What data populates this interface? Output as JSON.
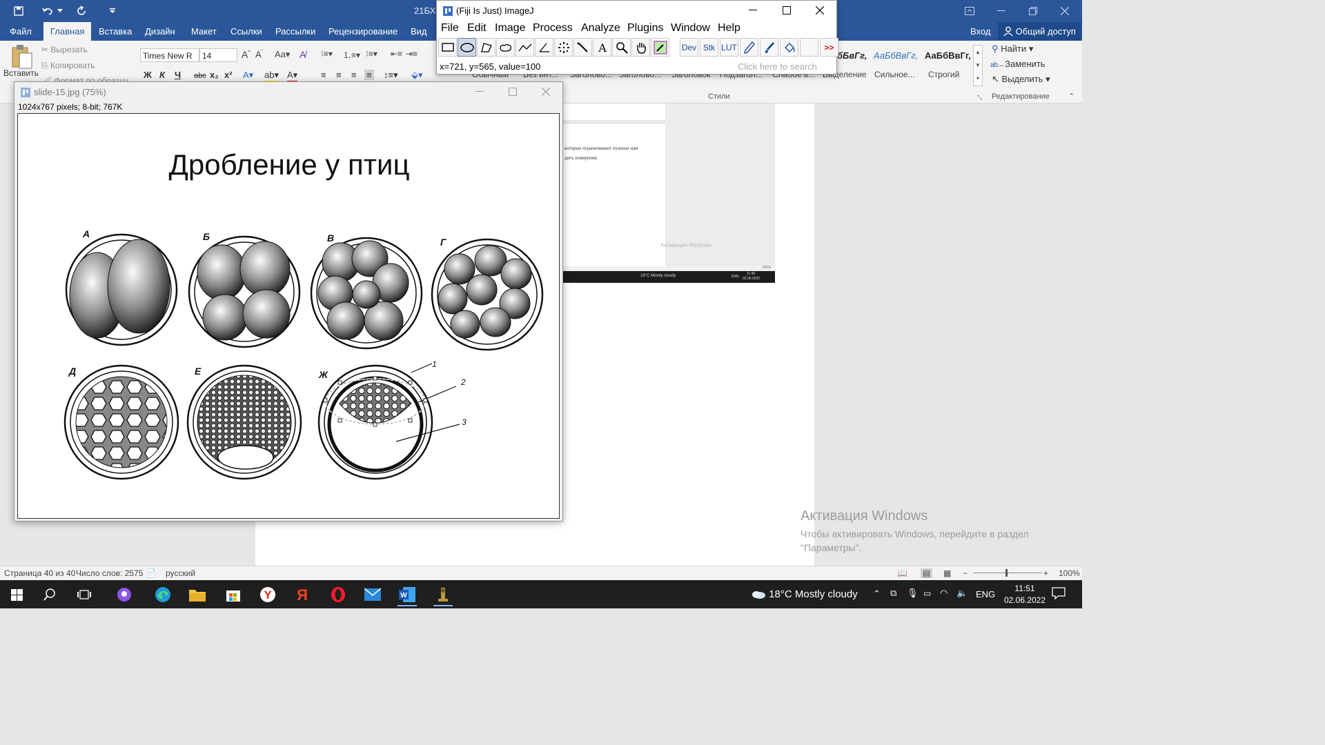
{
  "word": {
    "doc_title": "21БХ",
    "tabs": [
      "Файл",
      "Главная",
      "Вставка",
      "Дизайн",
      "Макет",
      "Ссылки",
      "Рассылки",
      "Рецензирование",
      "Вид"
    ],
    "active_tab": "Главная",
    "signin": "Вход",
    "share": "Общий доступ",
    "clipboard": {
      "paste": "Вставить",
      "cut": "Вырезать",
      "copy": "Копировать",
      "format_painter": "Формат по образцу"
    },
    "font": {
      "name": "Times New R",
      "size": "14"
    },
    "format_buttons": [
      "Ж",
      "К",
      "Ч",
      "abc",
      "x₂",
      "x²"
    ],
    "styles": {
      "previews": [
        "бБвГг,",
        "АаБбВвГг,",
        "АаБбВвГг,"
      ],
      "names": [
        "Обычный",
        "Без инт...",
        "Заголово...",
        "Заголово...",
        "Заголовок",
        "Подзагол...",
        "Слабое в...",
        "Выделение",
        "Сильное...",
        "Строгий"
      ],
      "group_label": "Стили"
    },
    "editing": {
      "find": "Найти",
      "replace": "Заменить",
      "select": "Выделить",
      "group_label": "Редактирование"
    },
    "embedded_text": [
      "которые ограничивают нужные нам",
      "дить измерения."
    ],
    "embedded_taskbar": {
      "weather": "18°C  Mostly cloudy",
      "lang": "ENG",
      "time": "11:49",
      "date": "02.06.2022",
      "zoom": "100%"
    },
    "embedded_watermark": "Активация Windows",
    "watermark": {
      "title": "Активация Windows",
      "text": "Чтобы активировать Windows, перейдите в раздел \"Параметры\"."
    },
    "status": {
      "page": "Страница 40 из 40",
      "words": "Число слов: 2575",
      "lang": "русский",
      "zoom": "100%"
    }
  },
  "imagej": {
    "title": "(Fiji Is Just) ImageJ",
    "menus": [
      "File",
      "Edit",
      "Image",
      "Process",
      "Analyze",
      "Plugins",
      "Window",
      "Help"
    ],
    "tools_text": [
      "Dev",
      "Stk",
      "LUT"
    ],
    "more": ">>",
    "status": "x=721, y=565, value=100",
    "search_placeholder": "Click here to search"
  },
  "image_window": {
    "title": "slide-15.jpg (75%)",
    "info": "1024x767 pixels; 8-bit; 767K",
    "slide_title": "Дробление у птиц",
    "labels": [
      "А",
      "Б",
      "В",
      "Г",
      "Д",
      "Е",
      "Ж"
    ],
    "callouts": [
      "1",
      "2",
      "3"
    ]
  },
  "taskbar": {
    "weather": "18°C  Mostly cloudy",
    "lang": "ENG",
    "time": "11:51",
    "date": "02.06.2022"
  }
}
